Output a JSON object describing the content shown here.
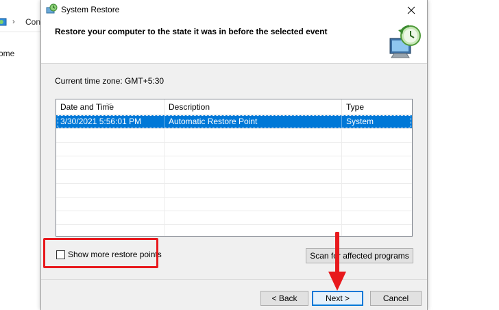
{
  "background": {
    "breadcrumb_fragment": "Con",
    "sidebar_fragment": "ome"
  },
  "dialog": {
    "title": "System Restore",
    "heading": "Restore your computer to the state it was in before the selected event",
    "timezone_text": "Current time zone: GMT+5:30",
    "table": {
      "columns": [
        "Date and Time",
        "Description",
        "Type"
      ],
      "rows": [
        {
          "date": "3/30/2021 5:56:01 PM",
          "description": "Automatic Restore Point",
          "type": "System",
          "selected": true
        }
      ]
    },
    "checkbox_label": "Show more restore points",
    "checkbox_checked": false,
    "scan_button": "Scan for affected programs",
    "back_button": "< Back",
    "next_button": "Next >",
    "cancel_button": "Cancel",
    "icons": [
      "close-icon",
      "system-restore-icon"
    ]
  },
  "colors": {
    "selection": "#0078d7",
    "annotation": "#e8191d"
  }
}
